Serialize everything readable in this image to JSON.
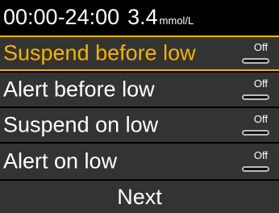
{
  "header": {
    "time_range": "00:00-24:00",
    "glucose_value": "3.4",
    "glucose_unit": "mmol/L"
  },
  "settings": [
    {
      "label": "Suspend before low",
      "state": "Off",
      "selected": true
    },
    {
      "label": "Alert before low",
      "state": "Off",
      "selected": false
    },
    {
      "label": "Suspend on low",
      "state": "Off",
      "selected": false
    },
    {
      "label": "Alert on low",
      "state": "Off",
      "selected": false
    }
  ],
  "footer": {
    "next_label": "Next"
  },
  "colors": {
    "selection_accent": "#f2b300",
    "row_background": "#333333",
    "screen_background": "#000000"
  }
}
